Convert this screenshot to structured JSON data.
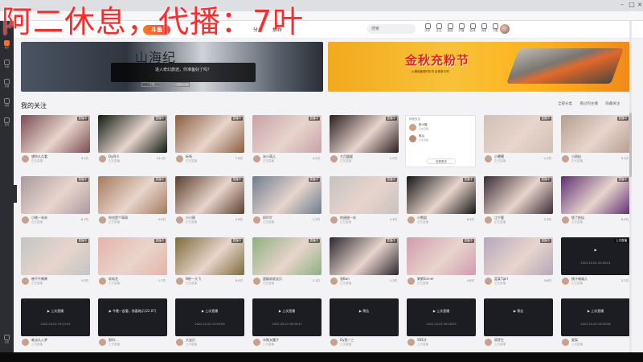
{
  "overlay": {
    "text": "阿二休息，代播：7叶"
  },
  "topnav": {
    "logo": "斗鱼",
    "links": [
      "分类",
      "推荐"
    ],
    "search_placeholder": "搜索",
    "icons": [
      {
        "name": "history-icon",
        "label": "历史"
      },
      {
        "name": "follow-icon",
        "label": "关注"
      },
      {
        "name": "video-icon",
        "label": "视频"
      },
      {
        "name": "live-icon",
        "label": "开播"
      },
      {
        "name": "game-icon",
        "label": "游戏"
      },
      {
        "name": "message-icon",
        "label": "消息"
      },
      {
        "name": "download-icon",
        "label": "下载"
      }
    ]
  },
  "left_rail": [
    "推荐",
    "分类",
    "直播",
    "视频",
    "游戏",
    "设置"
  ],
  "banners": {
    "left": {
      "title": "山海纪",
      "subtitle": "进入奇幻旅途，你准备好了吗？",
      "buttons": [
        "下载",
        "官网"
      ]
    },
    "right": {
      "title": "金秋充粉节",
      "subtitle": "火爆装备限时折扣 赶紧参与吧"
    }
  },
  "section": {
    "title": "我的关注",
    "tools": [
      "全部分类",
      "看过的主播",
      "隐藏关注"
    ]
  },
  "popup": {
    "header": "特别关注",
    "rows": [
      {
        "name": "张小猫",
        "sub": "正在直播"
      },
      {
        "name": "阿瓜",
        "sub": "正在直播"
      }
    ],
    "button": "查看更多"
  },
  "cards_row1": [
    {
      "name": "望你久久看",
      "status": "正在直播",
      "count": "9.1万",
      "badge": "直播中",
      "color": "#7a4c52"
    },
    {
      "name": "Dy阿少",
      "status": "正在直播",
      "count": "14.1万",
      "badge": "直播中",
      "color": "#0e1b12"
    },
    {
      "name": "栎呀",
      "status": "正在直播",
      "count": "7.6万",
      "badge": "直播中",
      "color": "#8a5d3e"
    },
    {
      "name": "米小萌儿",
      "status": "正在直播",
      "count": "3.2万",
      "badge": "直播中",
      "color": "#c9a1a8"
    },
    {
      "name": "七月媛媛",
      "status": "正在直播",
      "count": "2.0万",
      "badge": "直播中",
      "color": "#2a1e1f"
    },
    {
      "name": "",
      "status": "",
      "count": "",
      "badge": "",
      "color": "#ffffff"
    },
    {
      "name": "小曦曦",
      "status": "正在直播",
      "count": "1.9万",
      "badge": "直播中",
      "color": "#cfc0b4"
    },
    {
      "name": "小雨仙",
      "status": "正在直播",
      "count": "5.1万",
      "badge": "直播中",
      "color": "#b59e91"
    }
  ],
  "cards_row2": [
    {
      "name": "小桃一米米",
      "status": "正在直播",
      "count": "6.7万",
      "badge": "直播中",
      "color": "#a99aa0"
    },
    {
      "name": "你也是个萌萌",
      "status": "正在直播",
      "count": "3.0万",
      "badge": "直播中",
      "color": "#a47a5c"
    },
    {
      "name": "小小筱",
      "status": "正在直播",
      "count": "2.8万",
      "badge": "直播中",
      "color": "#5c3e2c"
    },
    {
      "name": "阿吖吖",
      "status": "正在直播",
      "count": "1.2万",
      "badge": "直播中",
      "color": "#6c7d8f"
    },
    {
      "name": "你甜甜一米",
      "status": "正在直播",
      "count": "4.4万",
      "badge": "直播中",
      "color": "#c7c1bf"
    },
    {
      "name": "小熊姐",
      "status": "正在直播",
      "count": "8.5万",
      "badge": "直播中",
      "color": "#151516"
    },
    {
      "name": "江宁鹿",
      "status": "正在直播",
      "count": "2.3万",
      "badge": "直播中",
      "color": "#3a2b36"
    },
    {
      "name": "锁了依仙",
      "status": "正在直播",
      "count": "6.0万",
      "badge": "直播中",
      "color": "#5e2f74"
    }
  ],
  "cards_row3": [
    {
      "name": "晓不不酱酱",
      "status": "正在直播",
      "count": "3.3万",
      "badge": "直播中",
      "color": "#c2c5c4"
    },
    {
      "name": "软软芝",
      "status": "正在直播",
      "count": "1.7万",
      "badge": "直播中",
      "color": "#e6b3a8"
    },
    {
      "name": "N射一大飞",
      "status": "正在直播",
      "count": "9.9万",
      "badge": "直播中",
      "color": "#7d6a3a"
    },
    {
      "name": "超级软软宝贝",
      "status": "正在直播",
      "count": "2.1万",
      "badge": "直播中",
      "color": "#8db07f"
    },
    {
      "name": "张Bun",
      "status": "正在直播",
      "count": "1.3万",
      "badge": "直播中",
      "color": "#2b2630"
    },
    {
      "name": "粥粥Sinner",
      "status": "正在直播",
      "count": "4.8万",
      "badge": "直播中",
      "color": "#d29ab0"
    },
    {
      "name": "蓝某Tgirl",
      "status": "正在直播",
      "count": "3.6万",
      "badge": "直播中",
      "color": "#b4a7bb"
    },
    {
      "name": "桃汁喵喵儿",
      "status": "正在直播",
      "count": "2.2万",
      "badge": "上次直播",
      "color": "#1a1c21",
      "offline": true,
      "ltitle": "",
      "ltime": "2022-10-02 02:40:01"
    }
  ],
  "cards_row4": [
    {
      "name": "唯淡久入梦",
      "status": "上次直播",
      "count": "",
      "badge": "",
      "offline": true,
      "ltitle": "上次直播",
      "ltime": "2022-10-02 19:13:01"
    },
    {
      "name": "那时...",
      "status": "上次直播",
      "count": "",
      "badge": "",
      "offline": true,
      "ltitle": "今晚一起看 , 惊喜暗示(22.07)",
      "ltime": ""
    },
    {
      "name": "大宝贝",
      "status": "上次直播",
      "count": "",
      "badge": "",
      "offline": true,
      "ltitle": "上次直播",
      "ltime": "2022-10-20 13:53:09"
    },
    {
      "name": "冰熊叉魔子",
      "status": "上次直播",
      "count": "",
      "badge": "",
      "offline": true,
      "ltitle": "上次直播",
      "ltime": "2022-09-20 16:30:47"
    },
    {
      "name": "Dy我一三",
      "status": "上次直播",
      "count": "",
      "badge": "",
      "offline": true,
      "ltitle": "预告",
      "ltime": ""
    },
    {
      "name": "SRE冷",
      "status": "上次直播",
      "count": "",
      "badge": "",
      "offline": true,
      "ltitle": "上次直播",
      "ltime": "2022-10-02 09:20:03"
    },
    {
      "name": "萌芽生",
      "status": "上次直播",
      "count": "",
      "badge": "",
      "offline": true,
      "ltitle": "预告",
      "ltime": ""
    },
    {
      "name": "夏梨",
      "status": "上次直播",
      "count": "",
      "badge": "",
      "offline": true,
      "ltitle": "上次直播",
      "ltime": "2022-10-05 19:50:08"
    }
  ]
}
